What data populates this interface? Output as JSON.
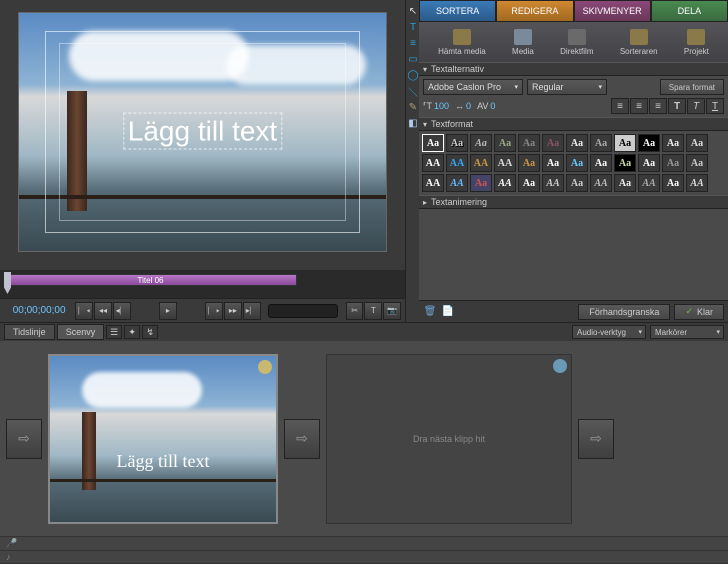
{
  "preview": {
    "title_placeholder": "Lägg till text",
    "clip_name": "Titel 06"
  },
  "transport": {
    "timecode": "00;00;00;00"
  },
  "tabs": {
    "sortera": "SORTERA",
    "redigera": "REDIGERA",
    "skivmenyer": "SKIVMENYER",
    "dela": "DELA"
  },
  "toolbar": {
    "hamta": "Hämta media",
    "media": "Media",
    "direktfilm": "Direktfilm",
    "sorteraren": "Sorteraren",
    "projekt": "Projekt"
  },
  "sections": {
    "textalternativ": "Textalternativ",
    "textformat": "Textformat",
    "textanimering": "Textanimering"
  },
  "textopts": {
    "font": "Adobe Caslon Pro",
    "weight": "Regular",
    "save_format": "Spara format",
    "size_label": "⸢T",
    "size": "100",
    "kerning": "0",
    "leading": "0"
  },
  "panel_footer": {
    "preview": "Förhandsgranska",
    "done": "Klar"
  },
  "bottom": {
    "tidslinje": "Tidslinje",
    "scenvy": "Scenvy",
    "audio_tools": "Audio-verktyg",
    "markers": "Markörer",
    "dropzone": "Dra nästa klipp hit",
    "thumb_text": "Lägg till text"
  },
  "style_samples": [
    "Aa",
    "Aa",
    "Aa",
    "Aa",
    "Aa",
    "Aa",
    "Aa",
    "Aa",
    "Aa",
    "Aa",
    "Aa",
    "Aa",
    "AA",
    "AA",
    "AA",
    "AA",
    "Aa",
    "Aa",
    "Aa",
    "Aa",
    "Aa",
    "Aa",
    "Aa",
    "Aa",
    "AA",
    "AA",
    "Aa",
    "AA",
    "Aa",
    "AA",
    "Aa",
    "AA",
    "Aa",
    "AA",
    "Aa",
    "AA"
  ]
}
